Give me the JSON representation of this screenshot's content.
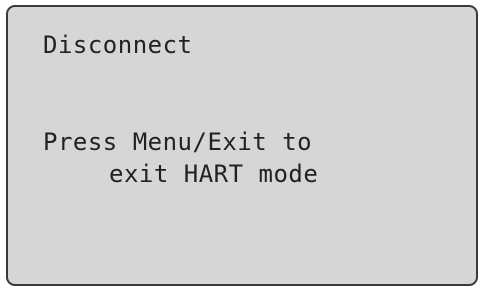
{
  "screen": {
    "title": "Disconnect",
    "message_line_1": "Press Menu/Exit to",
    "message_line_2": "exit HART mode",
    "background_color": "#d6d6d6",
    "border_color": "#3a3a3a",
    "text_color": "#222222"
  }
}
